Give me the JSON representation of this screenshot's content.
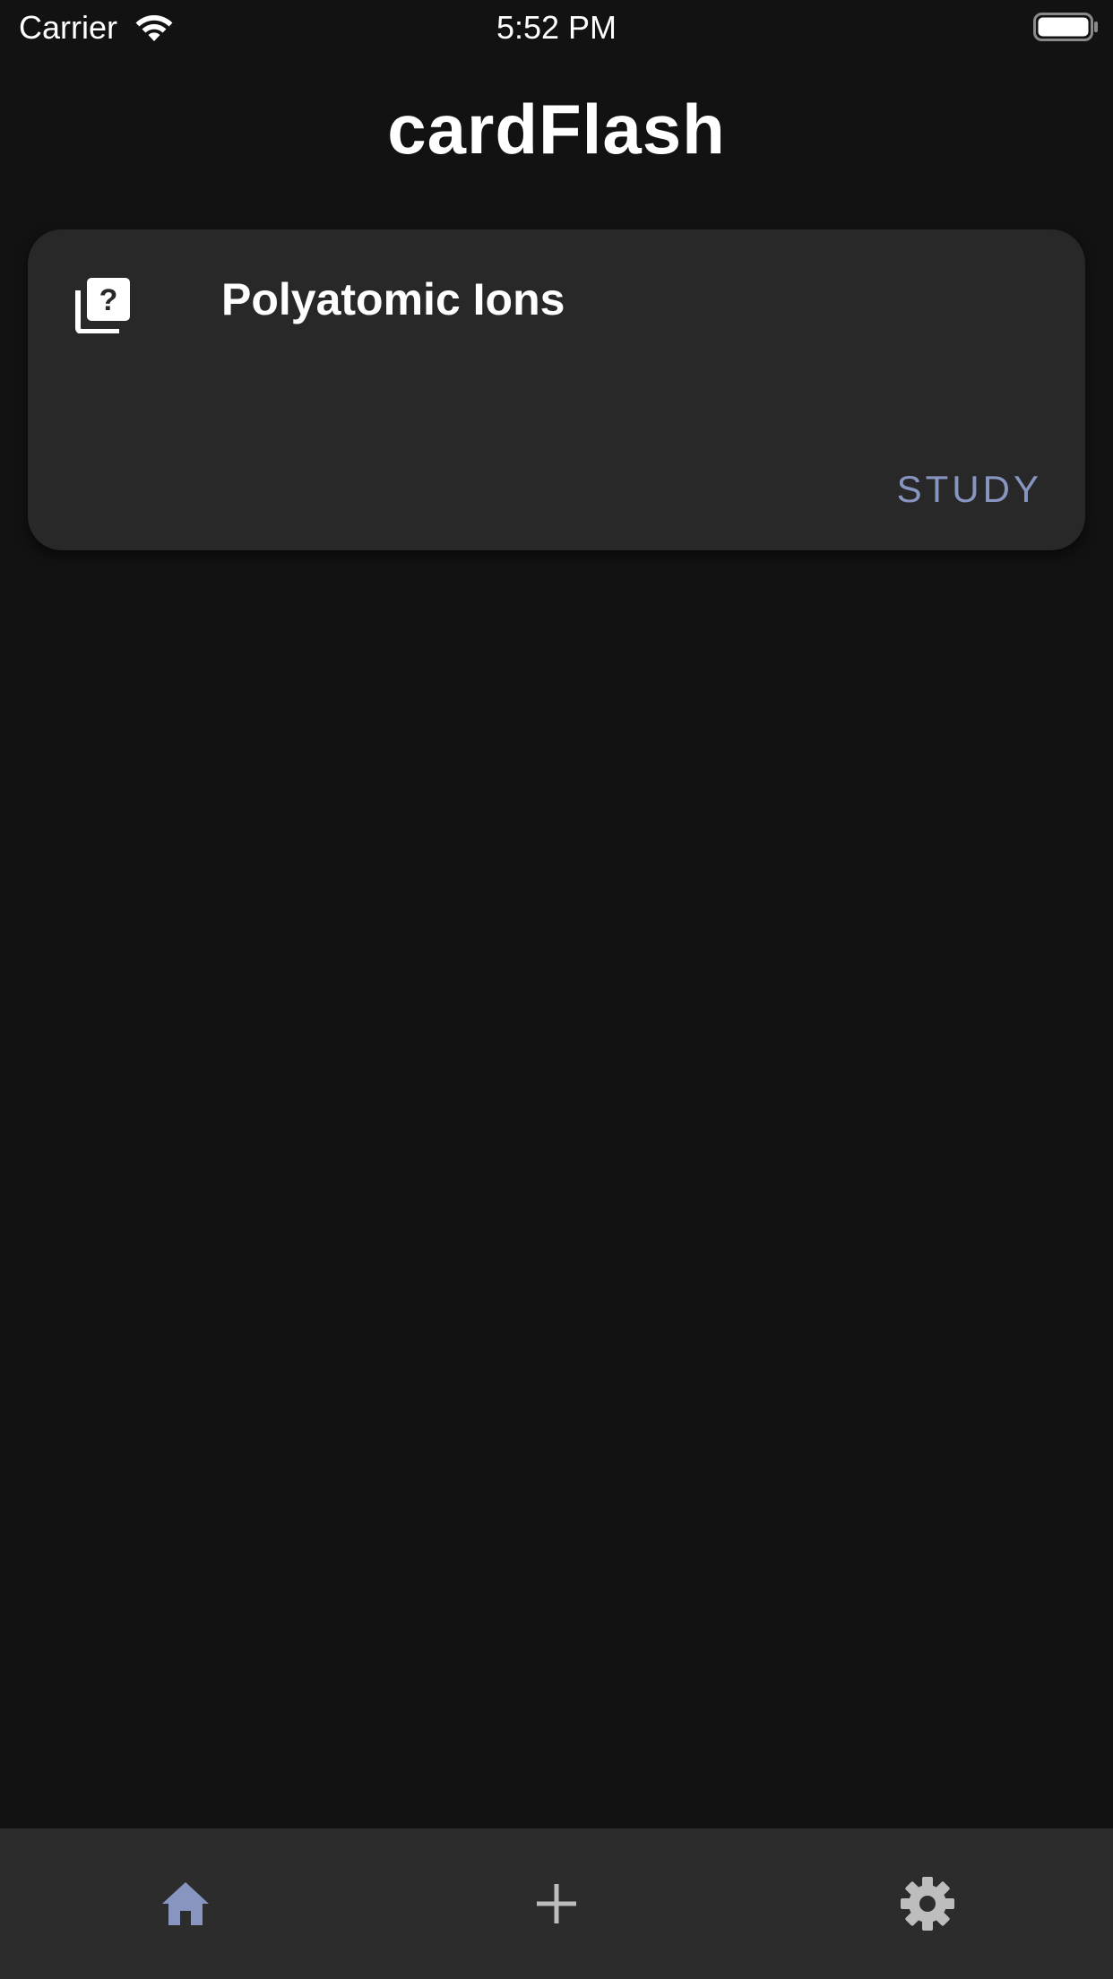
{
  "status_bar": {
    "carrier": "Carrier",
    "time": "5:52 PM"
  },
  "header": {
    "title": "cardFlash"
  },
  "decks": [
    {
      "title": "Polyatomic Ions",
      "icon": "quiz-icon",
      "action_label": "STUDY"
    }
  ],
  "bottom_nav": {
    "items": [
      {
        "icon": "home-icon",
        "active": true
      },
      {
        "icon": "add-icon",
        "active": false
      },
      {
        "icon": "gear-icon",
        "active": false
      }
    ]
  },
  "colors": {
    "background": "#121212",
    "card": "#282828",
    "accent": "#8795c0",
    "nav_bar": "#2c2c2c",
    "nav_inactive": "#bdbdbd"
  }
}
